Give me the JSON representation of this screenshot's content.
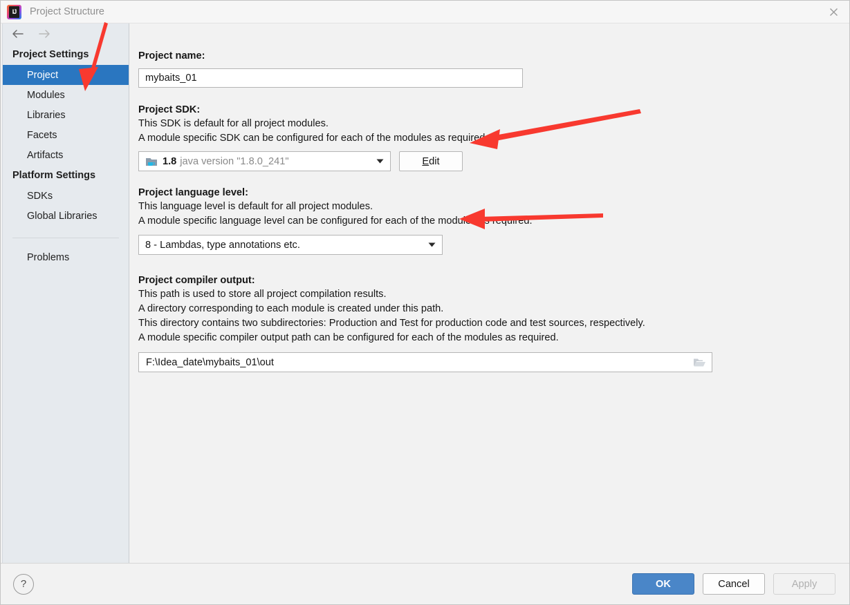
{
  "window": {
    "title": "Project Structure",
    "logo_text": "IJ",
    "close_icon": "close-icon"
  },
  "nav": {
    "back_icon": "arrow-left-icon",
    "forward_icon": "arrow-right-icon"
  },
  "sidebar": {
    "groups": [
      {
        "header": "Project Settings",
        "items": [
          {
            "label": "Project",
            "selected": true
          },
          {
            "label": "Modules",
            "selected": false
          },
          {
            "label": "Libraries",
            "selected": false
          },
          {
            "label": "Facets",
            "selected": false
          },
          {
            "label": "Artifacts",
            "selected": false
          }
        ]
      },
      {
        "header": "Platform Settings",
        "items": [
          {
            "label": "SDKs",
            "selected": false
          },
          {
            "label": "Global Libraries",
            "selected": false
          }
        ]
      }
    ],
    "problems_label": "Problems"
  },
  "main": {
    "project_name": {
      "label": "Project name:",
      "value": "mybaits_01"
    },
    "project_sdk": {
      "label": "Project SDK:",
      "desc_line1": "This SDK is default for all project modules.",
      "desc_line2": "A module specific SDK can be configured for each of the modules as required.",
      "selected_version": "1.8",
      "selected_desc": "java version \"1.8.0_241\"",
      "dropdown_icon": "chevron-down-icon",
      "sdk_icon": "java-sdk-icon",
      "edit_button": {
        "prefix": "",
        "mnemonic": "E",
        "suffix": "dit"
      }
    },
    "language_level": {
      "label": "Project language level:",
      "desc_line1": "This language level is default for all project modules.",
      "desc_line2": "A module specific language level can be configured for each of the modules as required.",
      "value": "8 - Lambdas, type annotations etc.",
      "dropdown_icon": "chevron-down-icon"
    },
    "compiler_output": {
      "label": "Project compiler output:",
      "desc_line1": "This path is used to store all project compilation results.",
      "desc_line2": "A directory corresponding to each module is created under this path.",
      "desc_line3": "This directory contains two subdirectories: Production and Test for production code and test sources, respectively.",
      "desc_line4": "A module specific compiler output path can be configured for each of the modules as required.",
      "value": "F:\\Idea_date\\mybaits_01\\out",
      "browse_icon": "folder-open-icon"
    }
  },
  "footer": {
    "help_icon": "question-mark-icon",
    "help_label": "?",
    "ok_label": "OK",
    "cancel_label": "Cancel",
    "apply_label": "Apply",
    "apply_enabled": false
  },
  "annotations": {
    "color": "#f8392f",
    "arrows": [
      {
        "name": "arrow-to-project-item"
      },
      {
        "name": "arrow-to-edit-button"
      },
      {
        "name": "arrow-to-language-level-combo"
      }
    ]
  }
}
